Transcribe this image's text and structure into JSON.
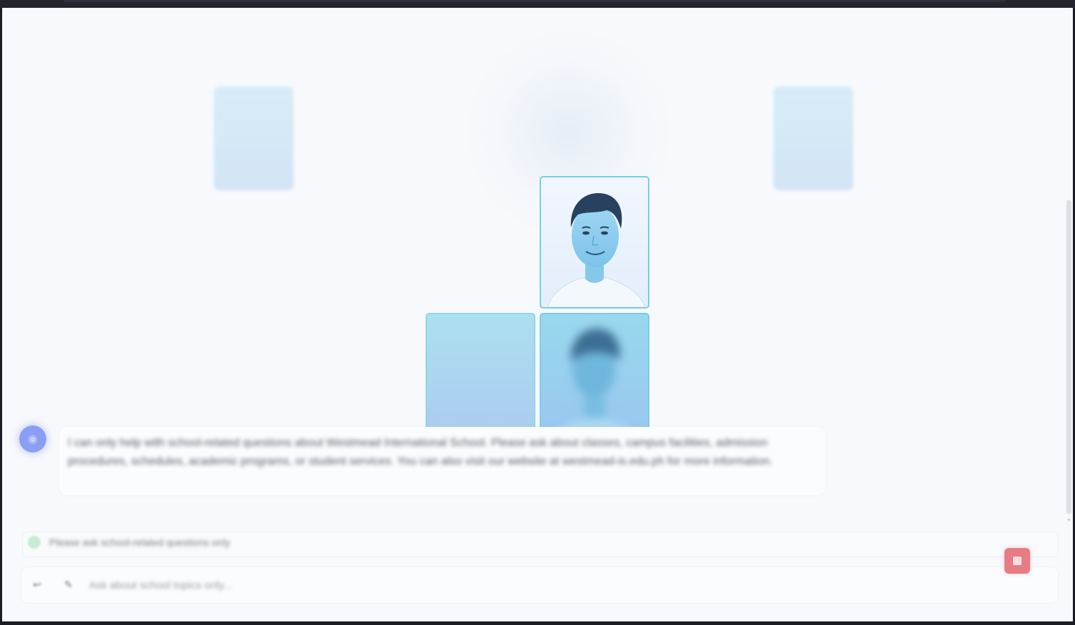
{
  "chat": {
    "bot_message": "I can only help with school-related questions about Westmead International School. Please ask about classes, campus facilities, admission procedures, schedules, academic programs, or student services. You can also visit our website at westmead-is.edu.ph for more information."
  },
  "notice": {
    "text": "Please ask school-related questions only"
  },
  "input": {
    "placeholder": "Ask about school topics only..."
  },
  "icons": {
    "bot_avatar": "robot-icon",
    "attach": "attach-icon",
    "tools": "tool-icon",
    "stop": "stop-icon"
  },
  "colors": {
    "tile_border": "#7dcbec",
    "stop_button": "#e87c84",
    "bot_avatar": "#8a9ff3"
  }
}
